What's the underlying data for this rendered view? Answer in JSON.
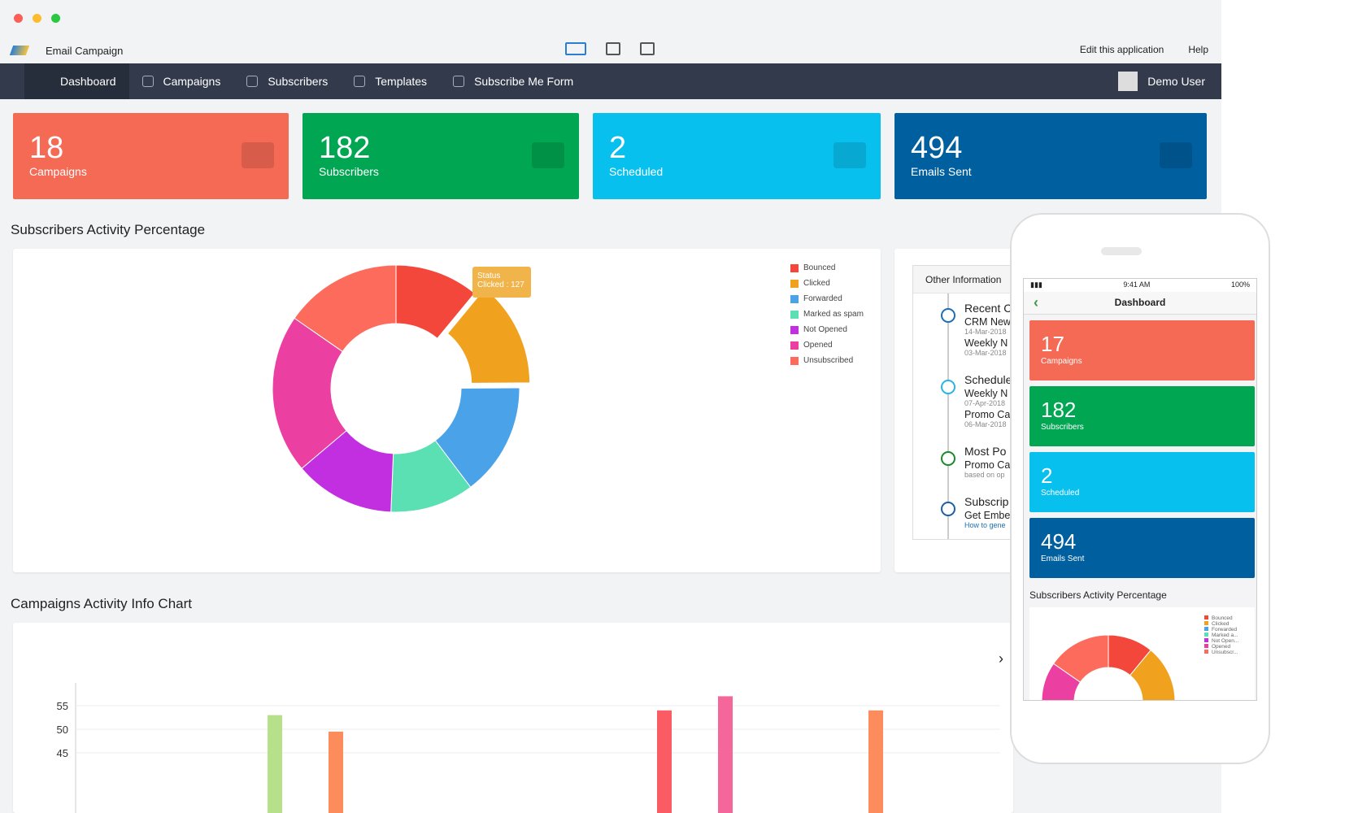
{
  "app": {
    "title": "Email Campaign",
    "edit": "Edit this application",
    "help": "Help"
  },
  "nav": {
    "items": [
      {
        "label": "Dashboard"
      },
      {
        "label": "Campaigns"
      },
      {
        "label": "Subscribers"
      },
      {
        "label": "Templates"
      },
      {
        "label": "Subscribe Me Form"
      }
    ],
    "user": "Demo User"
  },
  "cards": [
    {
      "value": "18",
      "label": "Campaigns",
      "color": "#f56a55",
      "icon": "megaphone-icon"
    },
    {
      "value": "182",
      "label": "Subscribers",
      "color": "#00a651",
      "icon": "rss-icon"
    },
    {
      "value": "2",
      "label": "Scheduled",
      "color": "#08c0ee",
      "icon": "calendar-icon"
    },
    {
      "value": "494",
      "label": "Emails Sent",
      "color": "#005f9e",
      "icon": "envelope-icon"
    }
  ],
  "donut_title": "Subscribers Activity Percentage",
  "tooltip": {
    "line1": "Status",
    "line2": "Clicked : 127"
  },
  "chart_data": [
    {
      "type": "pie",
      "donut": true,
      "categories": [
        "Bounced",
        "Clicked",
        "Forwarded",
        "Marked as spam",
        "Not Opened",
        "Opened",
        "Unsubscribed"
      ],
      "values": [
        100,
        127,
        135,
        100,
        120,
        190,
        140
      ],
      "colors": [
        "#f2473a",
        "#f0a21f",
        "#4aa3e8",
        "#5be0b3",
        "#c22fe0",
        "#ec3fa2",
        "#fd6b5d"
      ],
      "legend": "top-right"
    },
    {
      "type": "bar",
      "title": "Campaigns Activity Info Chart",
      "yticks": [
        45,
        50,
        55
      ],
      "values": [
        53,
        49.5,
        54,
        57,
        54
      ],
      "colors": [
        "#b6e08a",
        "#fd8c5d",
        "#fb5b62",
        "#f5679b",
        "#fd8c5d"
      ]
    }
  ],
  "bar_title": "Campaigns Activity Info Chart",
  "other": {
    "title": "Other Information",
    "sections": [
      {
        "head": "Recent C",
        "items": [
          {
            "t": "CRM New",
            "d": "14-Mar-2018"
          },
          {
            "t": "Weekly N",
            "d": "03-Mar-2018"
          }
        ]
      },
      {
        "head": "Schedule",
        "items": [
          {
            "t": "Weekly N",
            "d": "07-Apr-2018"
          },
          {
            "t": "Promo Ca",
            "d": "06-Mar-2018"
          }
        ]
      },
      {
        "head": "Most Po",
        "items": [
          {
            "t": "Promo Ca",
            "d": "based on op"
          }
        ]
      },
      {
        "head": "Subscrip",
        "items": [
          {
            "t": "Get Embe",
            "d": "How to gene"
          }
        ]
      }
    ]
  },
  "phone": {
    "time": "9:41 AM",
    "battery": "100%",
    "title": "Dashboard",
    "cards": [
      {
        "value": "17",
        "label": "Campaigns"
      },
      {
        "value": "182",
        "label": "Subscribers"
      },
      {
        "value": "2",
        "label": "Scheduled"
      },
      {
        "value": "494",
        "label": "Emails Sent"
      }
    ],
    "section": "Subscribers Activity Percentage",
    "legend": [
      "Bounced",
      "Clicked",
      "Forwarded",
      "Marked a...",
      "Not Open...",
      "Opened",
      "Unsubscr..."
    ]
  }
}
